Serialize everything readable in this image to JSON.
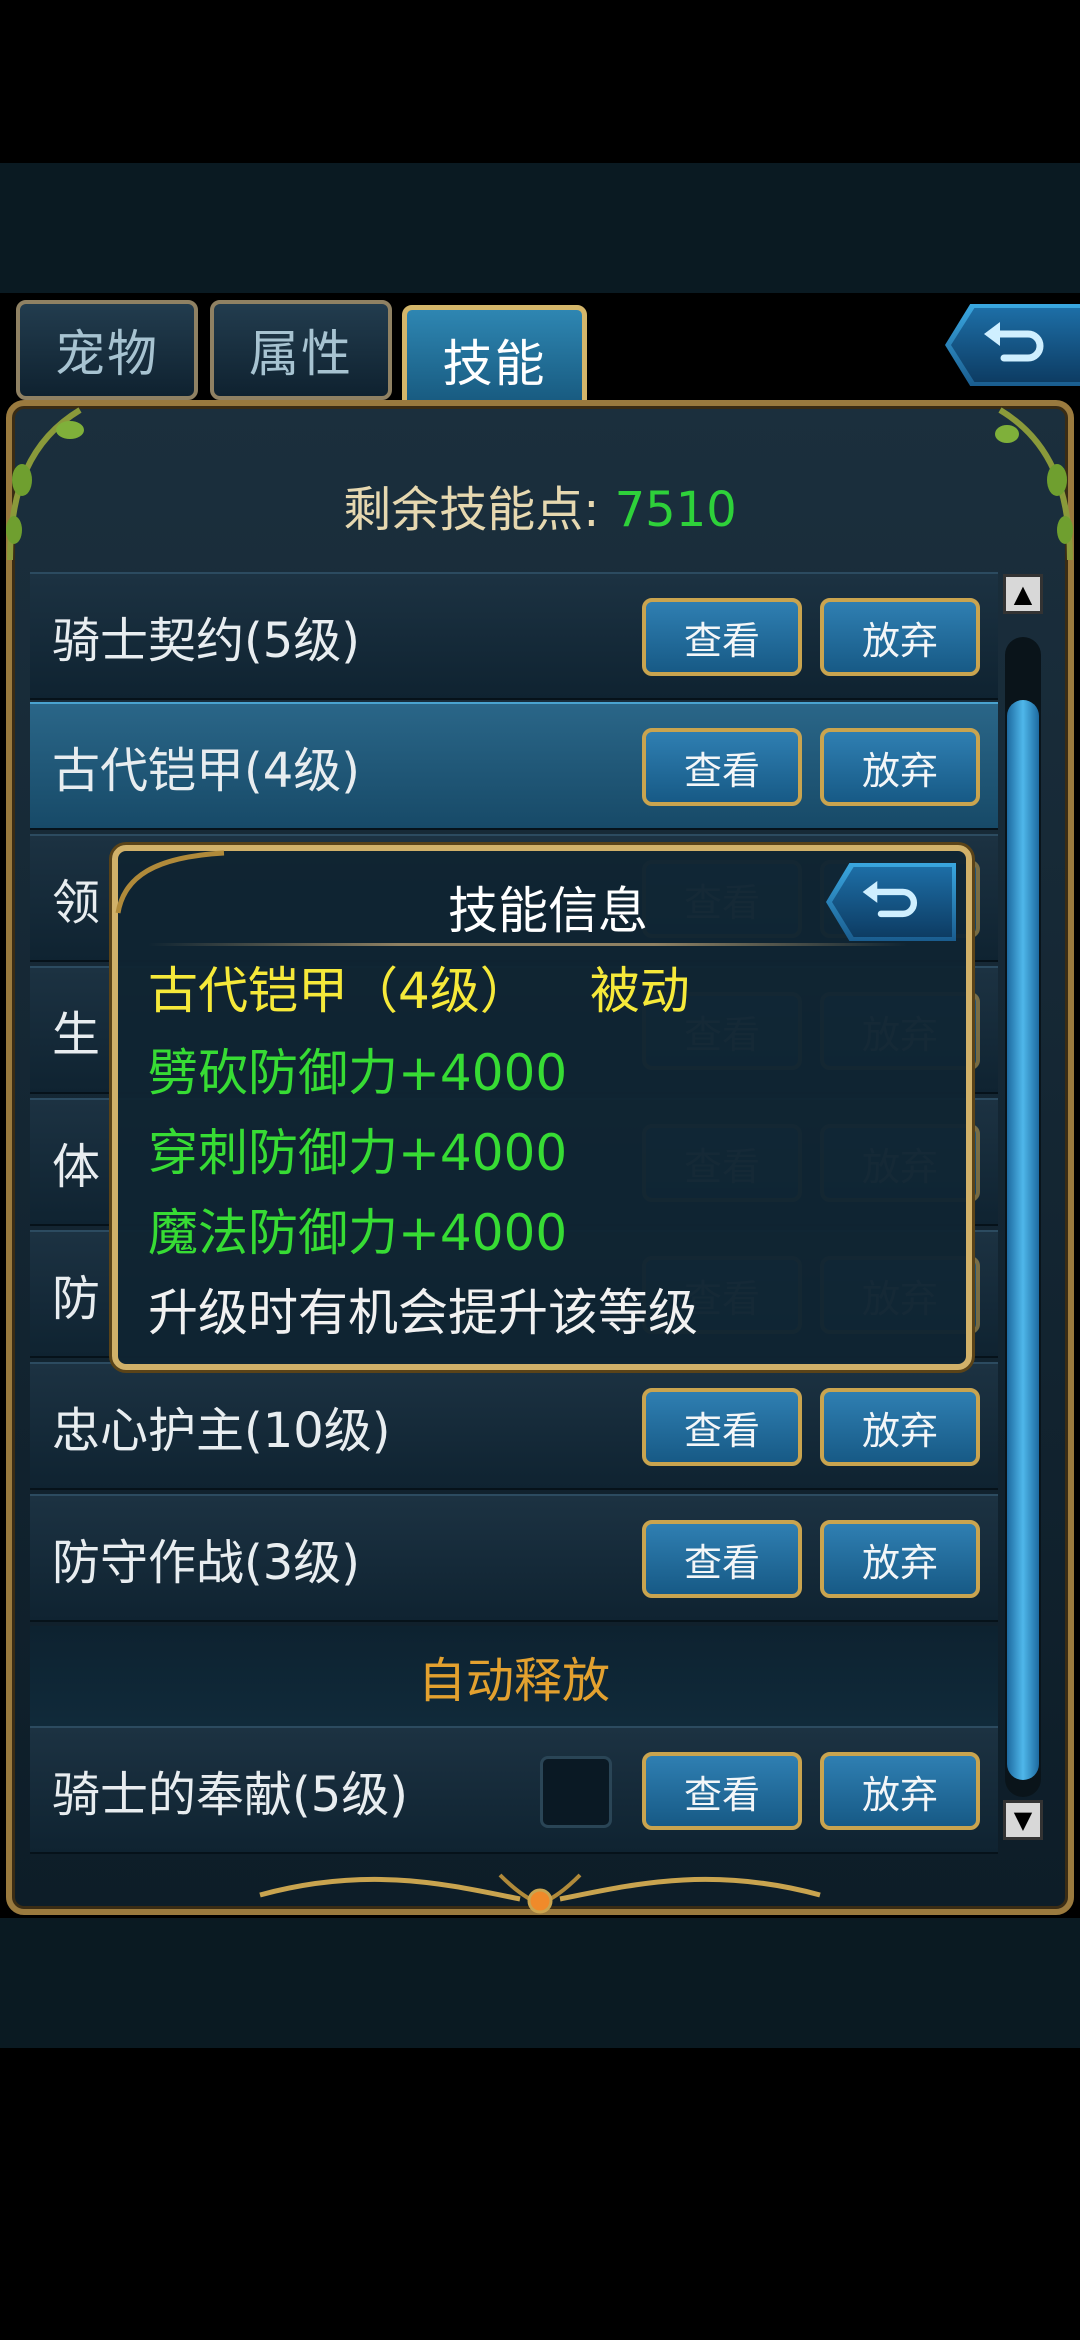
{
  "tabs": [
    {
      "label": "宠物",
      "active": false
    },
    {
      "label": "属性",
      "active": false
    },
    {
      "label": "技能",
      "active": true
    }
  ],
  "skill_points": {
    "label": "剩余技能点:",
    "value": "7510"
  },
  "skills": [
    {
      "name": "骑士契约(5级)",
      "view": "查看",
      "drop": "放弃"
    },
    {
      "name": "古代铠甲(4级)",
      "view": "查看",
      "drop": "放弃"
    },
    {
      "name": "领",
      "view": "查看",
      "drop": "放弃"
    },
    {
      "name": "生",
      "view": "查看",
      "drop": "放弃"
    },
    {
      "name": "体",
      "view": "查看",
      "drop": "放弃"
    },
    {
      "name": "防",
      "view": "查看",
      "drop": "放弃"
    },
    {
      "name": "忠心护主(10级)",
      "view": "查看",
      "drop": "放弃"
    },
    {
      "name": "防守作战(3级)",
      "view": "查看",
      "drop": "放弃"
    }
  ],
  "auto_release": {
    "header": "自动释放",
    "skill": {
      "name": "骑士的奉献(5级)",
      "view": "查看",
      "drop": "放弃",
      "checked": false
    }
  },
  "popup": {
    "title": "技能信息",
    "skill_name": "古代铠甲（4级）",
    "skill_type": "被动",
    "effects": [
      "劈砍防御力+4000",
      "穿刺防御力+4000",
      "魔法防御力+4000"
    ],
    "note": "升级时有机会提升该等级"
  },
  "colors": {
    "accent_green": "#2ed13a",
    "gold_border": "#d1b169",
    "orange_header": "#e3a12f",
    "yellow_text": "#f6e93a"
  }
}
